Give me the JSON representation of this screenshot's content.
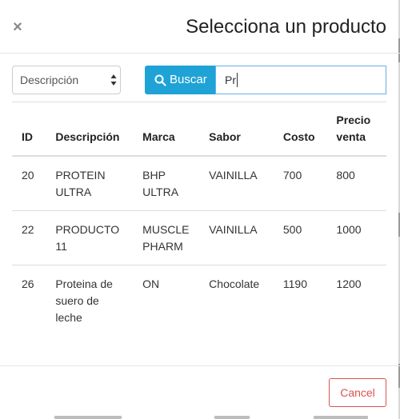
{
  "modal": {
    "title": "Selecciona un producto",
    "close_symbol": "×"
  },
  "search": {
    "field_select": {
      "selected": "Descripción"
    },
    "button_label": "Buscar",
    "input_value": "Pr"
  },
  "table": {
    "headers": {
      "id": "ID",
      "descripcion": "Descripción",
      "marca": "Marca",
      "sabor": "Sabor",
      "costo": "Costo",
      "precio_venta": "Precio venta"
    },
    "rows": [
      {
        "id": "20",
        "descripcion": "PROTEIN ULTRA",
        "marca": "BHP ULTRA",
        "sabor": "VAINILLA",
        "costo": "700",
        "precio_venta": "800"
      },
      {
        "id": "22",
        "descripcion": "PRODUCTO 11",
        "marca": "MUSCLE PHARM",
        "sabor": "VAINILLA",
        "costo": "500",
        "precio_venta": "1000"
      },
      {
        "id": "26",
        "descripcion": "Proteina de suero de leche",
        "marca": "ON",
        "sabor": "Chocolate",
        "costo": "1190",
        "precio_venta": "1200"
      }
    ]
  },
  "footer": {
    "cancel_label": "Cancel"
  },
  "colors": {
    "primary": "#1fa3d6",
    "danger": "#d9534f",
    "focus_border": "#66afe9"
  },
  "icons": {
    "close": "close-icon",
    "search": "search-icon",
    "select_arrows": "select-arrows-icon"
  }
}
